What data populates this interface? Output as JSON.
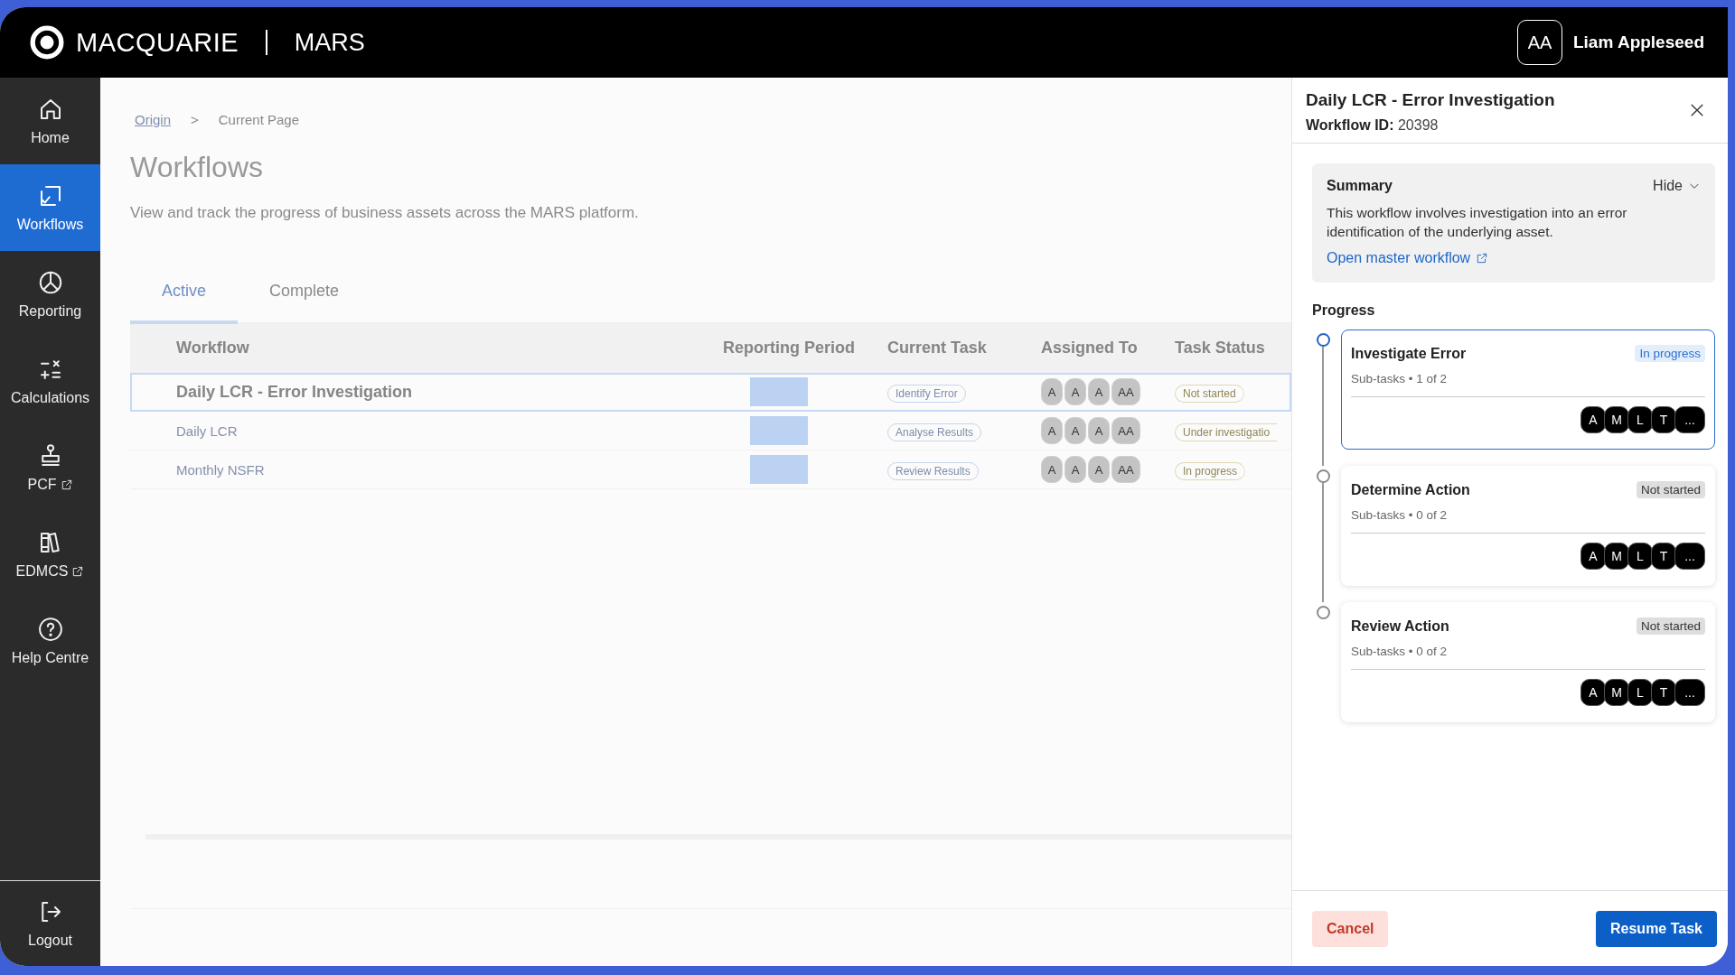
{
  "header": {
    "brand": "MACQUARIE",
    "product": "MARS",
    "user": {
      "initials": "AA",
      "name": "Liam Appleseed"
    }
  },
  "sidebar": {
    "items": [
      {
        "label": "Home",
        "selected": false,
        "external": false
      },
      {
        "label": "Workflows",
        "selected": true,
        "external": false
      },
      {
        "label": "Reporting",
        "selected": false,
        "external": false
      },
      {
        "label": "Calculations",
        "selected": false,
        "external": false
      },
      {
        "label": "PCF",
        "selected": false,
        "external": true
      },
      {
        "label": "EDMCS",
        "selected": false,
        "external": true
      },
      {
        "label": "Help Centre",
        "selected": false,
        "external": false
      }
    ],
    "footer_item": {
      "label": "Logout"
    }
  },
  "page": {
    "breadcrumb": {
      "origin": "Origin",
      "separator": ">",
      "current": "Current Page"
    },
    "title": "Workflows",
    "subtitle": "View and track the progress of business assets across the MARS platform.",
    "tabs": [
      {
        "label": "Active",
        "selected": true
      },
      {
        "label": "Complete",
        "selected": false
      }
    ],
    "table": {
      "columns": [
        "Workflow",
        "Reporting Period",
        "Current Task",
        "Assigned To",
        "Task Status"
      ],
      "rows": [
        {
          "workflow": "Daily LCR - Error Investigation",
          "current_task": "Identify Error",
          "assignees": [
            "A",
            "A",
            "A",
            "AA"
          ],
          "task_status": "Not started",
          "selected": true
        },
        {
          "workflow": "Daily LCR",
          "current_task": "Analyse Results",
          "assignees": [
            "A",
            "A",
            "A",
            "AA"
          ],
          "task_status": "Under investigatio",
          "selected": false
        },
        {
          "workflow": "Monthly NSFR",
          "current_task": "Review Results",
          "assignees": [
            "A",
            "A",
            "A",
            "AA"
          ],
          "task_status": "In progress",
          "selected": false
        }
      ]
    }
  },
  "panel": {
    "title": "Daily LCR - Error Investigation",
    "id_label": "Workflow ID:",
    "id_value": "20398",
    "summary": {
      "heading": "Summary",
      "toggle": "Hide",
      "text": "This workflow involves investigation into an error identification of the underlying asset.",
      "link": "Open master workflow"
    },
    "progress": {
      "heading": "Progress",
      "steps": [
        {
          "title": "Investigate Error",
          "status": "In progress",
          "in_progress": true,
          "active": true,
          "subtasks": "Sub-tasks • 1 of 2",
          "assignees": [
            "A",
            "M",
            "L",
            "T",
            "..."
          ]
        },
        {
          "title": "Determine Action",
          "status": "Not started",
          "in_progress": false,
          "active": false,
          "subtasks": "Sub-tasks • 0 of 2",
          "assignees": [
            "A",
            "M",
            "L",
            "T",
            "..."
          ]
        },
        {
          "title": "Review Action",
          "status": "Not started",
          "in_progress": false,
          "active": false,
          "subtasks": "Sub-tasks • 0 of 2",
          "assignees": [
            "A",
            "M",
            "L",
            "T",
            "..."
          ]
        }
      ]
    },
    "buttons": {
      "cancel": "Cancel",
      "primary": "Resume Task"
    }
  }
}
